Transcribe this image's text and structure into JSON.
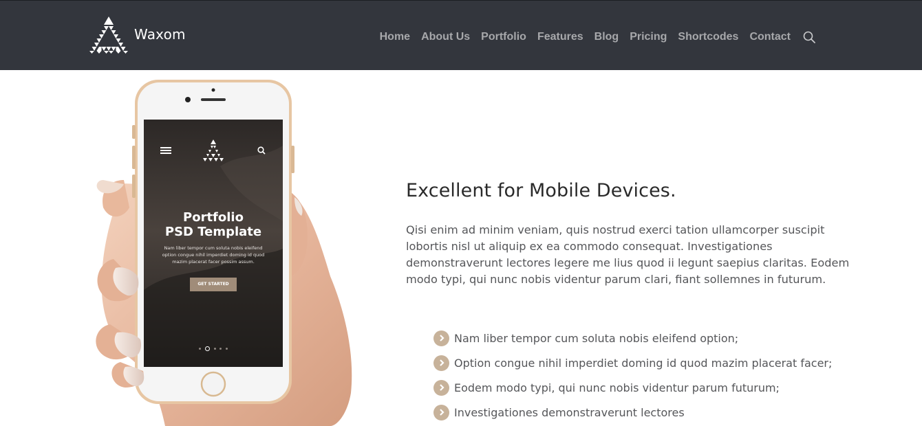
{
  "brand": {
    "name": "Waxom"
  },
  "nav": {
    "items": [
      "Home",
      "About Us",
      "Portfolio",
      "Features",
      "Blog",
      "Pricing",
      "Shortcodes",
      "Contact"
    ],
    "search_icon": "search-icon"
  },
  "phone_screen": {
    "title_line1": "Portfolio",
    "title_line2": "PSD Template",
    "body": "Nam liber tempor cum soluta nobis eleifend option congue nihil imperdiet doming id quod mazim placerat facer possim assum.",
    "cta": "GET STARTED",
    "menu_icon": "hamburger-icon",
    "search_icon": "search-icon",
    "active_slide": 2,
    "slide_count": 5
  },
  "section": {
    "headline": "Excellent for Mobile Devices.",
    "paragraph": "Qisi enim ad minim veniam, quis nostrud exerci tation ullamcorper suscipit lobortis nisl ut aliquip ex ea commodo consequat. Investigationes demonstraverunt lectores legere me lius quod ii legunt saepius claritas. Eodem modo typi, qui nunc nobis videntur parum clari, fiant sollemnes in futurum.",
    "features": [
      "Nam liber tempor cum soluta nobis eleifend option;",
      "Option congue nihil imperdiet doming id quod mazim placerat facer;",
      "Eodem modo typi, qui nunc nobis videntur parum futurum;",
      "Investigationes demonstraverunt lectores"
    ]
  },
  "colors": {
    "header_bg": "#33363d",
    "nav_text": "#a7a8ab",
    "accent": "#c7b29a",
    "button_bg": "#a08c79"
  }
}
